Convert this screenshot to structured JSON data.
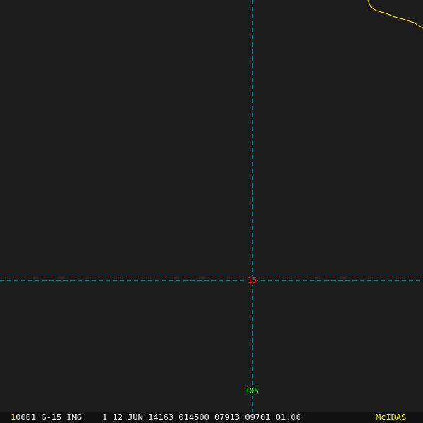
{
  "overlay": {
    "latitude_label": "15",
    "longitude_label": "105",
    "line_color": "#00e5ff",
    "lat_label_color": "#ff0000",
    "lon_label_color": "#00ff00",
    "coastline_color": "#ffff00"
  },
  "status_bar": {
    "frame_number": "1",
    "info": "0001 G-15 IMG    1 12 JUN 14163 014500 07913 09701 01.00",
    "brand": "McIDAS"
  }
}
